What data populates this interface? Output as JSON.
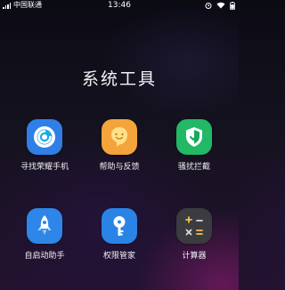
{
  "status_bar": {
    "carrier": "中国联通",
    "time": "13:46"
  },
  "folder": {
    "title": "系统工具"
  },
  "apps": [
    {
      "label": "寻找荣耀手机",
      "icon": "find-phone-icon",
      "color": "#2f7fe6"
    },
    {
      "label": "帮助与反馈",
      "icon": "help-feedback-icon",
      "color": "#f3a43a"
    },
    {
      "label": "骚扰拦截",
      "icon": "block-shield-icon",
      "color": "#22b866"
    },
    {
      "label": "自启动助手",
      "icon": "rocket-icon",
      "color": "#2e86e8"
    },
    {
      "label": "权限管家",
      "icon": "key-icon",
      "color": "#2a84e6"
    },
    {
      "label": "计算器",
      "icon": "calculator-icon",
      "color": "#3b3b40"
    }
  ]
}
